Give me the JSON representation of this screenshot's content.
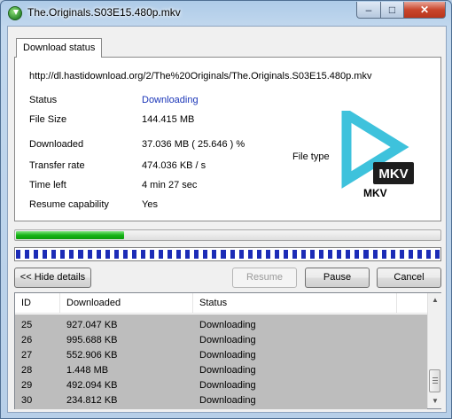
{
  "window": {
    "title": "The.Originals.S03E15.480p.mkv",
    "minimize_glyph": "–",
    "maximize_glyph": "□",
    "close_glyph": "✕"
  },
  "tab": {
    "label": "Download status"
  },
  "url": "http://dl.hastidownload.org/2/The%20Originals/The.Originals.S03E15.480p.mkv",
  "fields": [
    {
      "label": "Status",
      "value": "Downloading"
    },
    {
      "label": "File Size",
      "value": "144.415  MB"
    },
    {
      "label": "Downloaded",
      "value": " 37.036  MB  ( 25.646 ) %"
    },
    {
      "label": "Transfer rate",
      "value": "474.036  KB / s"
    },
    {
      "label": "Time left",
      "value": "4 min 27 sec"
    },
    {
      "label": "Resume capability",
      "value": " Yes"
    }
  ],
  "file_type": {
    "label": "File type",
    "extension": "MKV",
    "icon": "mkv-file-icon",
    "badge_text": "MKV"
  },
  "progress": {
    "fraction": 0.256,
    "color": "#17b417"
  },
  "segments": {
    "count": 48,
    "color": "#1c2cb7"
  },
  "buttons": {
    "hide_details": "<< Hide details",
    "resume": "Resume",
    "pause": "Pause",
    "cancel": "Cancel"
  },
  "connections": {
    "columns": [
      "ID",
      "Downloaded",
      "Status"
    ],
    "rows": [
      {
        "id": "25",
        "downloaded": "927.047 KB",
        "status": "Downloading"
      },
      {
        "id": "26",
        "downloaded": "995.688 KB",
        "status": "Downloading"
      },
      {
        "id": "27",
        "downloaded": "552.906 KB",
        "status": "Downloading"
      },
      {
        "id": "28",
        "downloaded": "1.448 MB",
        "status": "Downloading"
      },
      {
        "id": "29",
        "downloaded": "492.094 KB",
        "status": "Downloading"
      },
      {
        "id": "30",
        "downloaded": "234.812 KB",
        "status": "Downloading"
      }
    ]
  }
}
